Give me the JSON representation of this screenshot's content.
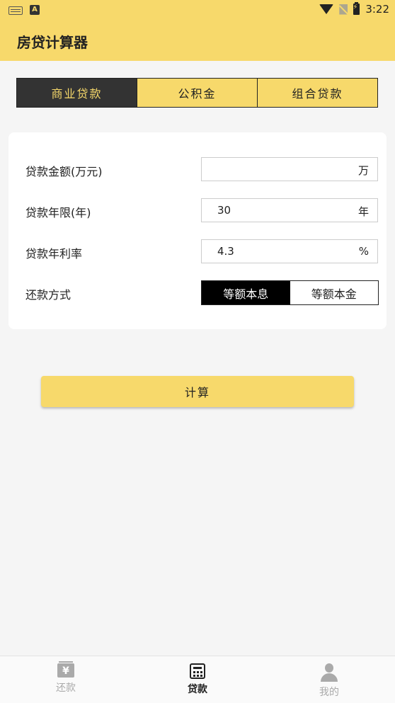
{
  "status_bar": {
    "time": "3:22",
    "a_label": "A"
  },
  "app_bar": {
    "title": "房贷计算器"
  },
  "tabs": [
    {
      "label": "商业贷款",
      "active": true
    },
    {
      "label": "公积金",
      "active": false
    },
    {
      "label": "组合贷款",
      "active": false
    }
  ],
  "form": {
    "amount": {
      "label": "贷款金额(万元)",
      "value": "",
      "unit": "万"
    },
    "term": {
      "label": "贷款年限(年)",
      "value": "30",
      "unit": "年"
    },
    "rate": {
      "label": "贷款年利率",
      "value": "4.3",
      "unit": "%"
    },
    "method": {
      "label": "还款方式",
      "options": [
        "等额本息",
        "等额本金"
      ],
      "selected": "等额本息"
    }
  },
  "calculate_button": {
    "label": "计算"
  },
  "bottom_nav": [
    {
      "label": "还款",
      "icon": "yen-icon",
      "active": false
    },
    {
      "label": "贷款",
      "icon": "calculator-icon",
      "active": true
    },
    {
      "label": "我的",
      "icon": "person-icon",
      "active": false
    }
  ],
  "colors": {
    "accent": "#f7d96b",
    "dark": "#333333",
    "background": "#f5f5f5"
  }
}
